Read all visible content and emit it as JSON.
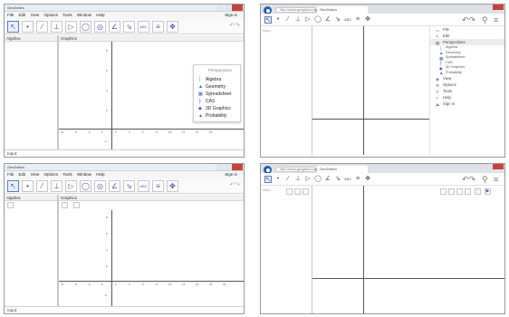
{
  "desktop": {
    "window_title": "GeoGebra",
    "menu": [
      "File",
      "Edit",
      "View",
      "Options",
      "Tools",
      "Window",
      "Help"
    ],
    "sign_in": "Sign in",
    "algebra_label": "Algebra",
    "graphics_label": "Graphics",
    "input_label": "Input:",
    "tools": [
      "↖",
      "•",
      "⁄",
      "⊥",
      "▷",
      "◯",
      "◎",
      "∠",
      "⇘",
      "ABC",
      "≡",
      "✥"
    ],
    "perspectives": {
      "title": "Perspectives",
      "items": [
        {
          "label": "Algebra",
          "icon": "algebra-icon"
        },
        {
          "label": "Geometry",
          "icon": "geometry-icon"
        },
        {
          "label": "Spreadsheet",
          "icon": "spreadsheet-icon"
        },
        {
          "label": "CAS",
          "icon": "cas-icon"
        },
        {
          "label": "3D Graphics",
          "icon": "3d-graphics-icon"
        },
        {
          "label": "Probability",
          "icon": "probability-icon"
        }
      ]
    },
    "x_ticks": [
      "-8",
      "-6",
      "-4",
      "-2",
      "0",
      "2",
      "4",
      "6",
      "8",
      "10",
      "12",
      "14",
      "16"
    ],
    "y_ticks": [
      "8",
      "6",
      "4",
      "2",
      "-2",
      "-4"
    ]
  },
  "web": {
    "tab_title": "GeoGebra",
    "url": "http://www.geogebra.org",
    "input_label": "Input...",
    "tools": [
      "↖",
      "•",
      "⁄",
      "⊥",
      "▷",
      "◯",
      "∠",
      "⇘",
      "ABC",
      "≡",
      "✥"
    ],
    "menu_right": [
      {
        "label": "File",
        "icon": "file-icon",
        "sub": false
      },
      {
        "label": "Edit",
        "icon": "edit-icon",
        "sub": false
      },
      {
        "label": "Perspectives",
        "icon": "perspectives-icon",
        "sub": false,
        "hl": true
      },
      {
        "label": "Algebra",
        "icon": "algebra-icon",
        "sub": true
      },
      {
        "label": "Geometry",
        "icon": "geometry-icon",
        "sub": true
      },
      {
        "label": "Spreadsheet",
        "icon": "spreadsheet-icon",
        "sub": true
      },
      {
        "label": "CAS",
        "icon": "cas-icon",
        "sub": true
      },
      {
        "label": "3D Graphics",
        "icon": "3d-graphics-icon",
        "sub": true
      },
      {
        "label": "Probability",
        "icon": "probability-icon",
        "sub": true
      },
      {
        "label": "View",
        "icon": "view-icon",
        "sub": false
      },
      {
        "label": "Options",
        "icon": "options-icon",
        "sub": false
      },
      {
        "label": "Tools",
        "icon": "tools-icon",
        "sub": false
      },
      {
        "label": "Help",
        "icon": "help-icon",
        "sub": false
      },
      {
        "label": "Sign in",
        "icon": "sign-in-icon",
        "sub": false
      }
    ]
  }
}
